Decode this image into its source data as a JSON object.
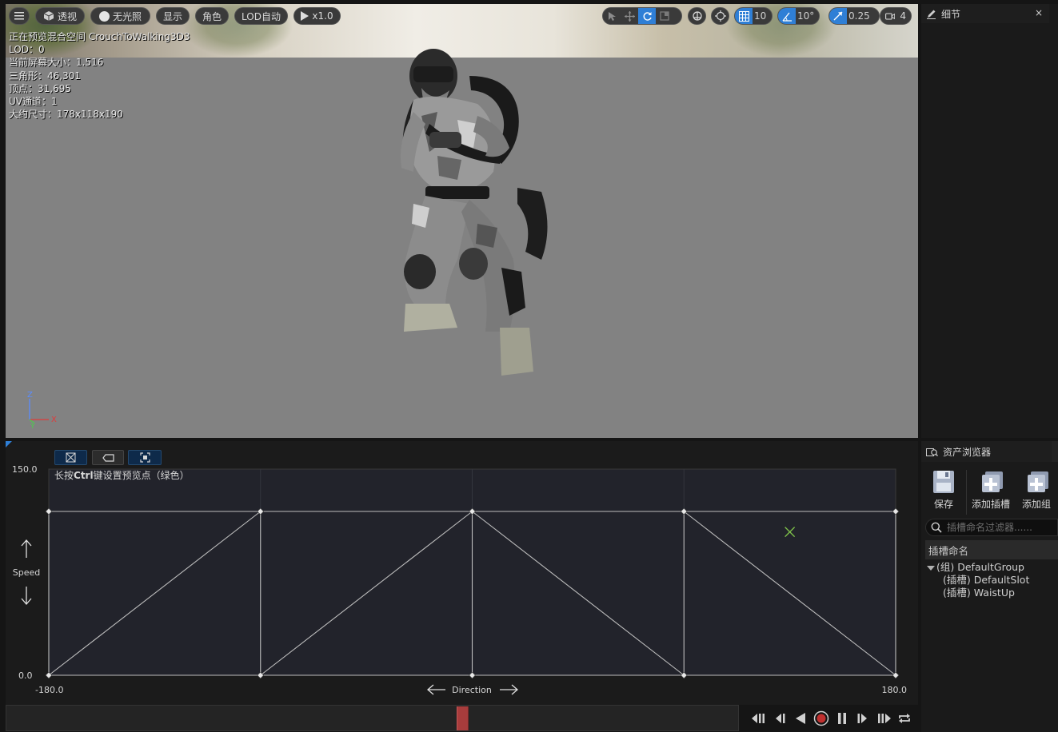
{
  "viewport": {
    "toolbar": {
      "menu_icon": "hamburger-icon",
      "perspective_label": "透视",
      "lighting_label": "无光照",
      "show_label": "显示",
      "character_label": "角色",
      "lod_label": "LOD自动",
      "play_speed_label": "x1.0",
      "grid_snap_value": "10",
      "rotation_snap_value": "10°",
      "scale_snap_value": "0.25",
      "camera_speed_value": "4"
    },
    "stats": [
      "正在预览混合空间 CrouchToWalking3D3",
      "LOD：0",
      "当前屏幕大小：1.516",
      "三角形：46,301",
      "顶点：31,695",
      "UV通道：1",
      "大约尺寸：178x118x190"
    ],
    "axis": {
      "z": "Z",
      "y": "Y",
      "x": "X"
    }
  },
  "details": {
    "tab_label": "细节",
    "close_label": "×"
  },
  "asset_browser": {
    "tab_label": "资产浏览器",
    "actions": [
      {
        "label": "保存",
        "icon": "save-disk-icon"
      },
      {
        "label": "添加插槽",
        "icon": "add-slot-icon"
      },
      {
        "label": "添加组",
        "icon": "add-group-icon"
      }
    ],
    "filter_placeholder": "插槽命名过滤器......",
    "header": "插槽命名",
    "group_row": "(组) DefaultGroup",
    "slots": [
      "(插槽) DefaultSlot",
      "(插槽) WaistUp"
    ]
  },
  "blend_space": {
    "hint_prefix": "长按",
    "hint_key": "Ctrl",
    "hint_suffix": "键设置预览点（绿色）",
    "y_axis_name": "Speed",
    "y_max_label": "150.0",
    "y_min_label": "0.0",
    "x_axis_name": "Direction",
    "x_min_label": "-180.0",
    "x_max_label": "180.0",
    "x_range": [
      -180,
      180
    ],
    "y_range": [
      0,
      150
    ],
    "samples": [
      {
        "x": -180,
        "y": 0
      },
      {
        "x": -90,
        "y": 0
      },
      {
        "x": 0,
        "y": 0
      },
      {
        "x": 90,
        "y": 0
      },
      {
        "x": 180,
        "y": 0
      },
      {
        "x": -180,
        "y": 150
      },
      {
        "x": -90,
        "y": 150
      },
      {
        "x": 0,
        "y": 150
      },
      {
        "x": 90,
        "y": 150
      },
      {
        "x": 180,
        "y": 150
      }
    ],
    "preview_point": {
      "x": 135,
      "y": 131.25
    }
  },
  "timeline": {
    "playhead_fraction": 0.625
  },
  "colors": {
    "accent_blue": "#2f7fd6",
    "playhead_red": "#a83c3c",
    "preview_green": "#7fc24a",
    "record_red": "#c0302f"
  }
}
